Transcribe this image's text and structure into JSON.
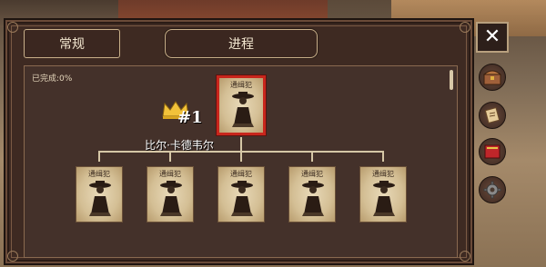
{
  "tabs": {
    "normal": "常规",
    "progress": "进程"
  },
  "progress": {
    "completed_text": "已完成:0%"
  },
  "boss": {
    "rank": "#1",
    "name": "比尔·卡德韦尔",
    "poster_title": "通缉犯"
  },
  "minions": [
    {
      "poster_title": "通缉犯"
    },
    {
      "poster_title": "通缉犯"
    },
    {
      "poster_title": "通缉犯"
    },
    {
      "poster_title": "通缉犯"
    },
    {
      "poster_title": "通缉犯"
    }
  ],
  "close_label": "✕",
  "side_buttons": [
    "chest-icon",
    "scroll-icon",
    "book-icon",
    "gear-icon"
  ],
  "colors": {
    "boss_border": "#c8261c",
    "panel": "#3e2a22",
    "poster": "#e8d9b8"
  }
}
